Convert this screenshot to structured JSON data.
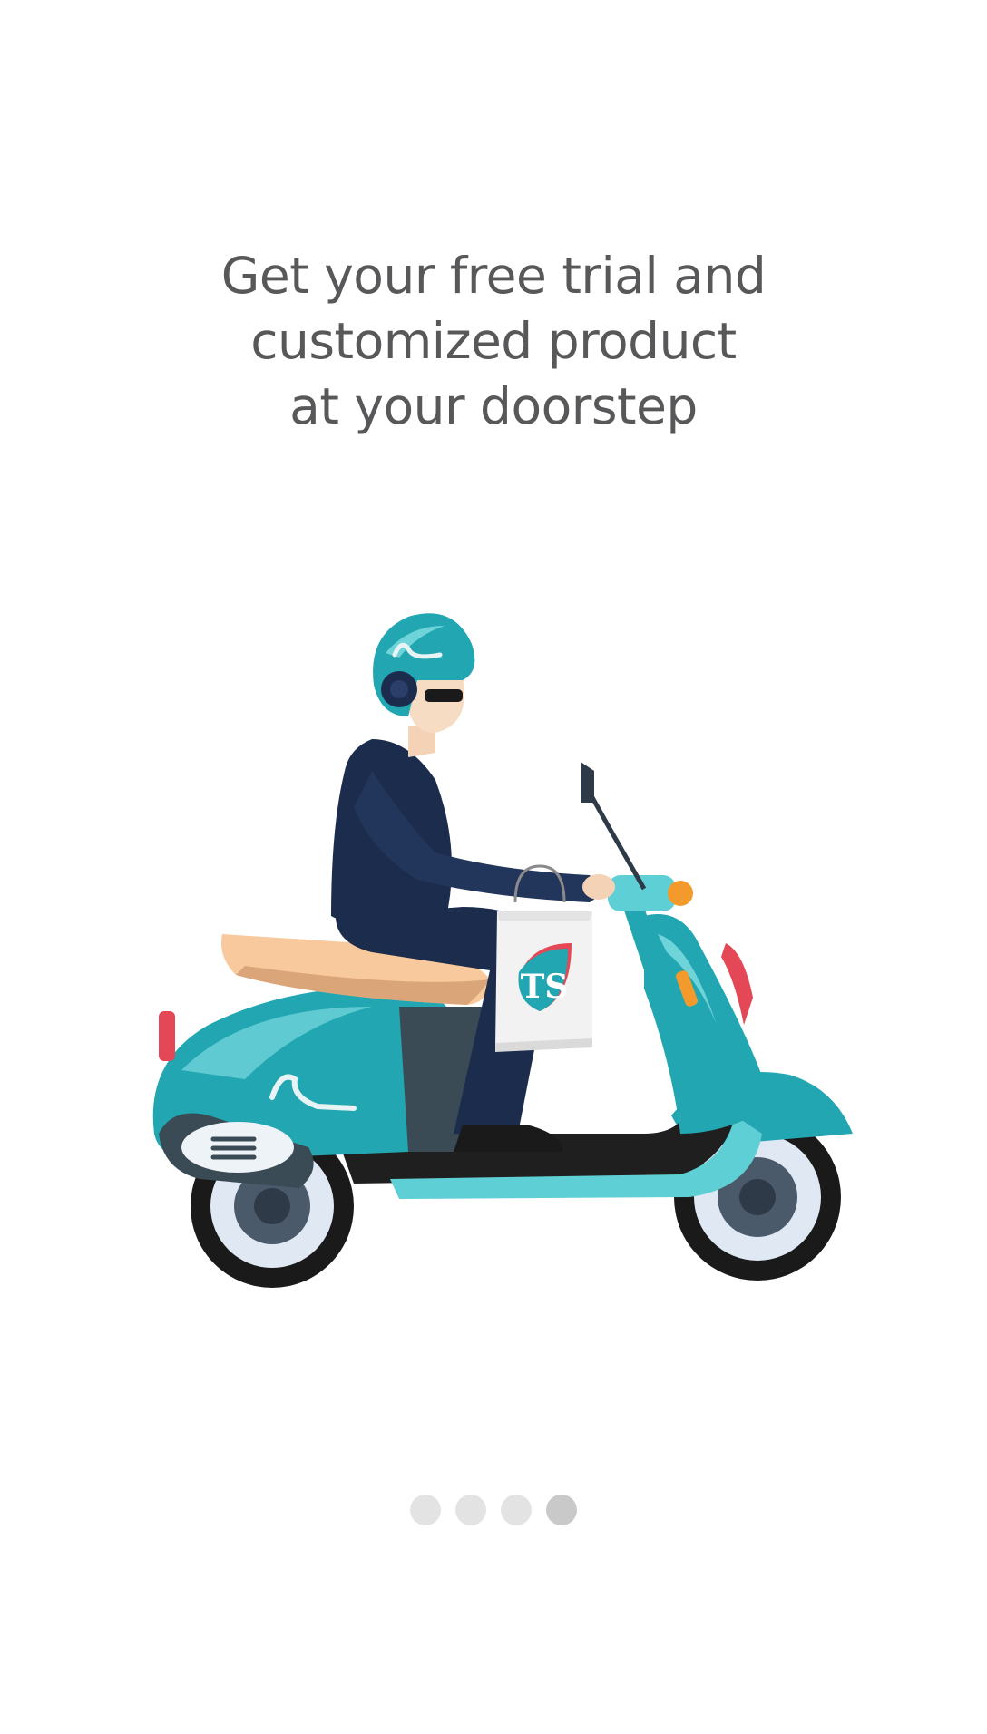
{
  "onboarding": {
    "headline_lines": [
      "Get your free trial and",
      "customized product",
      "at your doorstep"
    ],
    "bag_logo_text": "TS",
    "illustration_icon": "delivery-scooter-rider"
  },
  "pager": {
    "total": 4,
    "active_index": 3
  },
  "colors": {
    "text": "#58585a",
    "teal": "#22a6b1",
    "navy": "#1b2c4d",
    "dot_inactive": "#e3e3e3",
    "dot_active": "#c9c9c9"
  }
}
